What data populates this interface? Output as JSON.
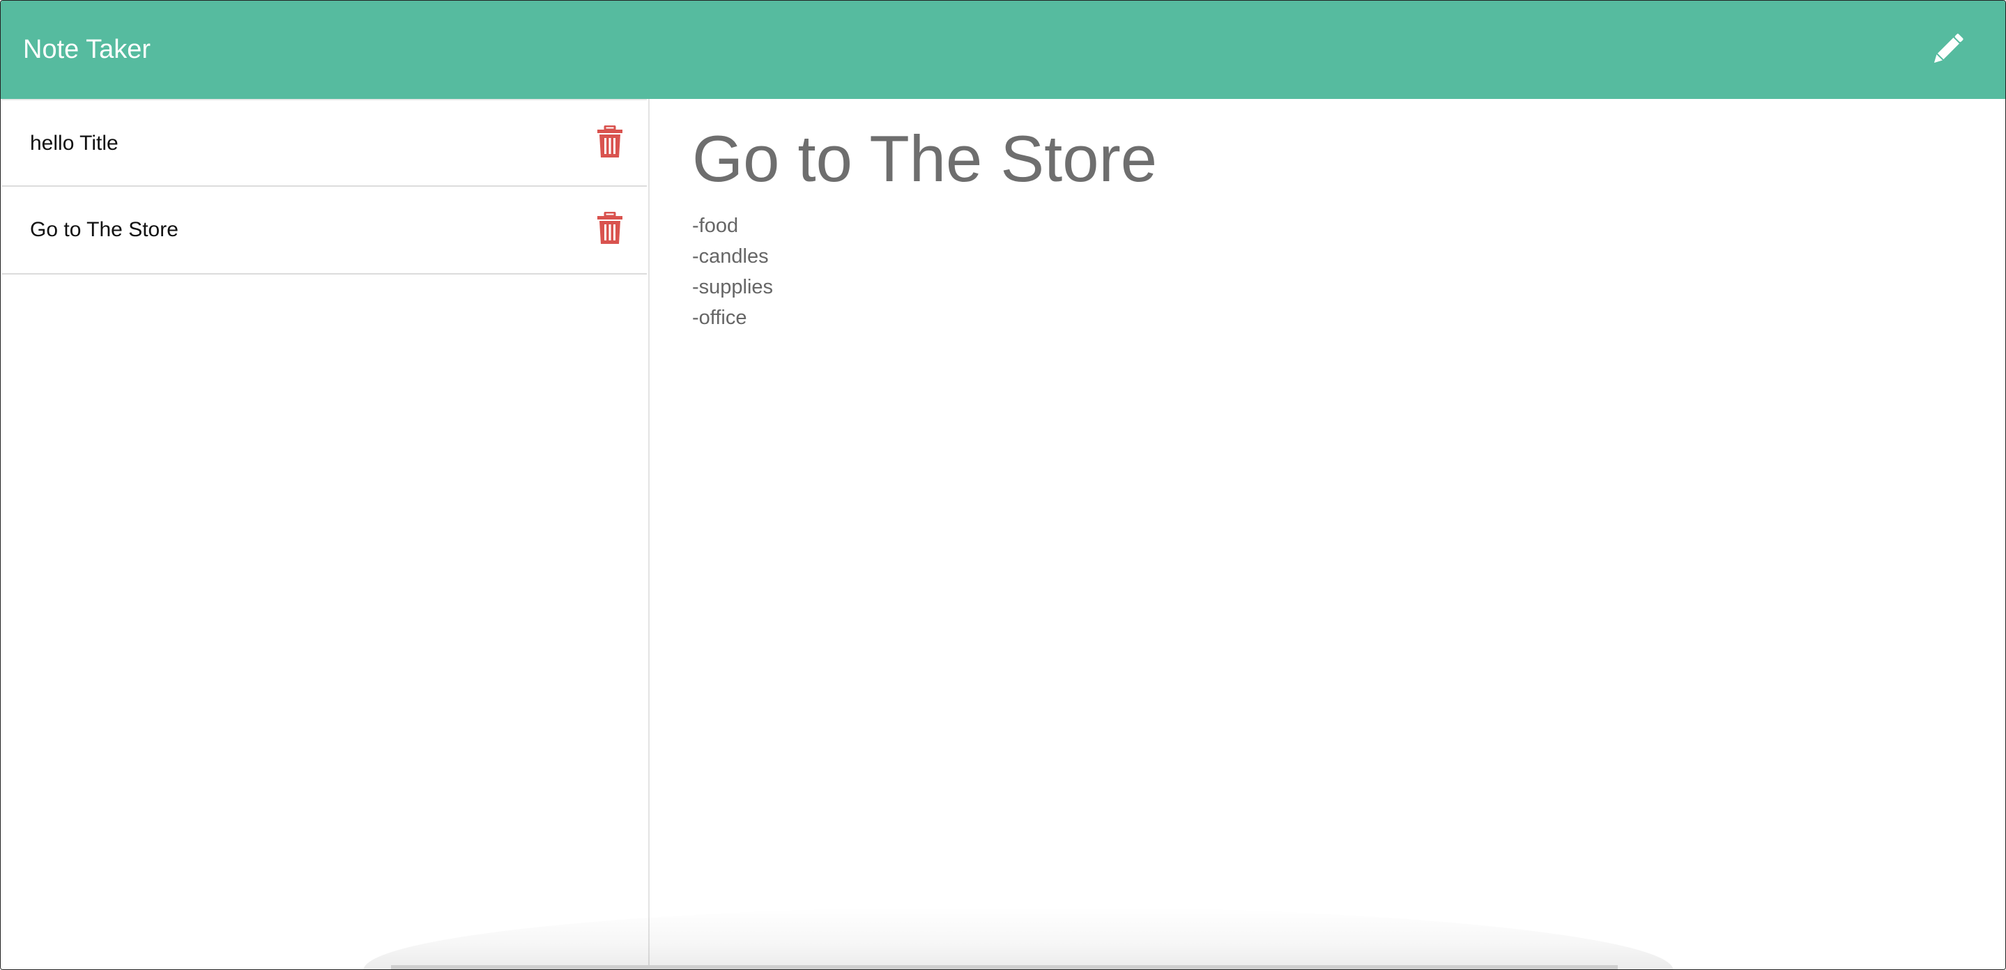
{
  "navbar": {
    "brand": "Note Taker",
    "new_note_icon": "pencil-icon",
    "background_color": "#56bb9f"
  },
  "sidebar": {
    "notes": [
      {
        "title": "hello Title",
        "delete_icon": "trash-icon"
      },
      {
        "title": "Go to The Store",
        "delete_icon": "trash-icon"
      }
    ],
    "delete_color": "#d9534f"
  },
  "main": {
    "note_title": "Go to The Store",
    "note_text": "-food\n-candles\n-supplies\n-office"
  }
}
